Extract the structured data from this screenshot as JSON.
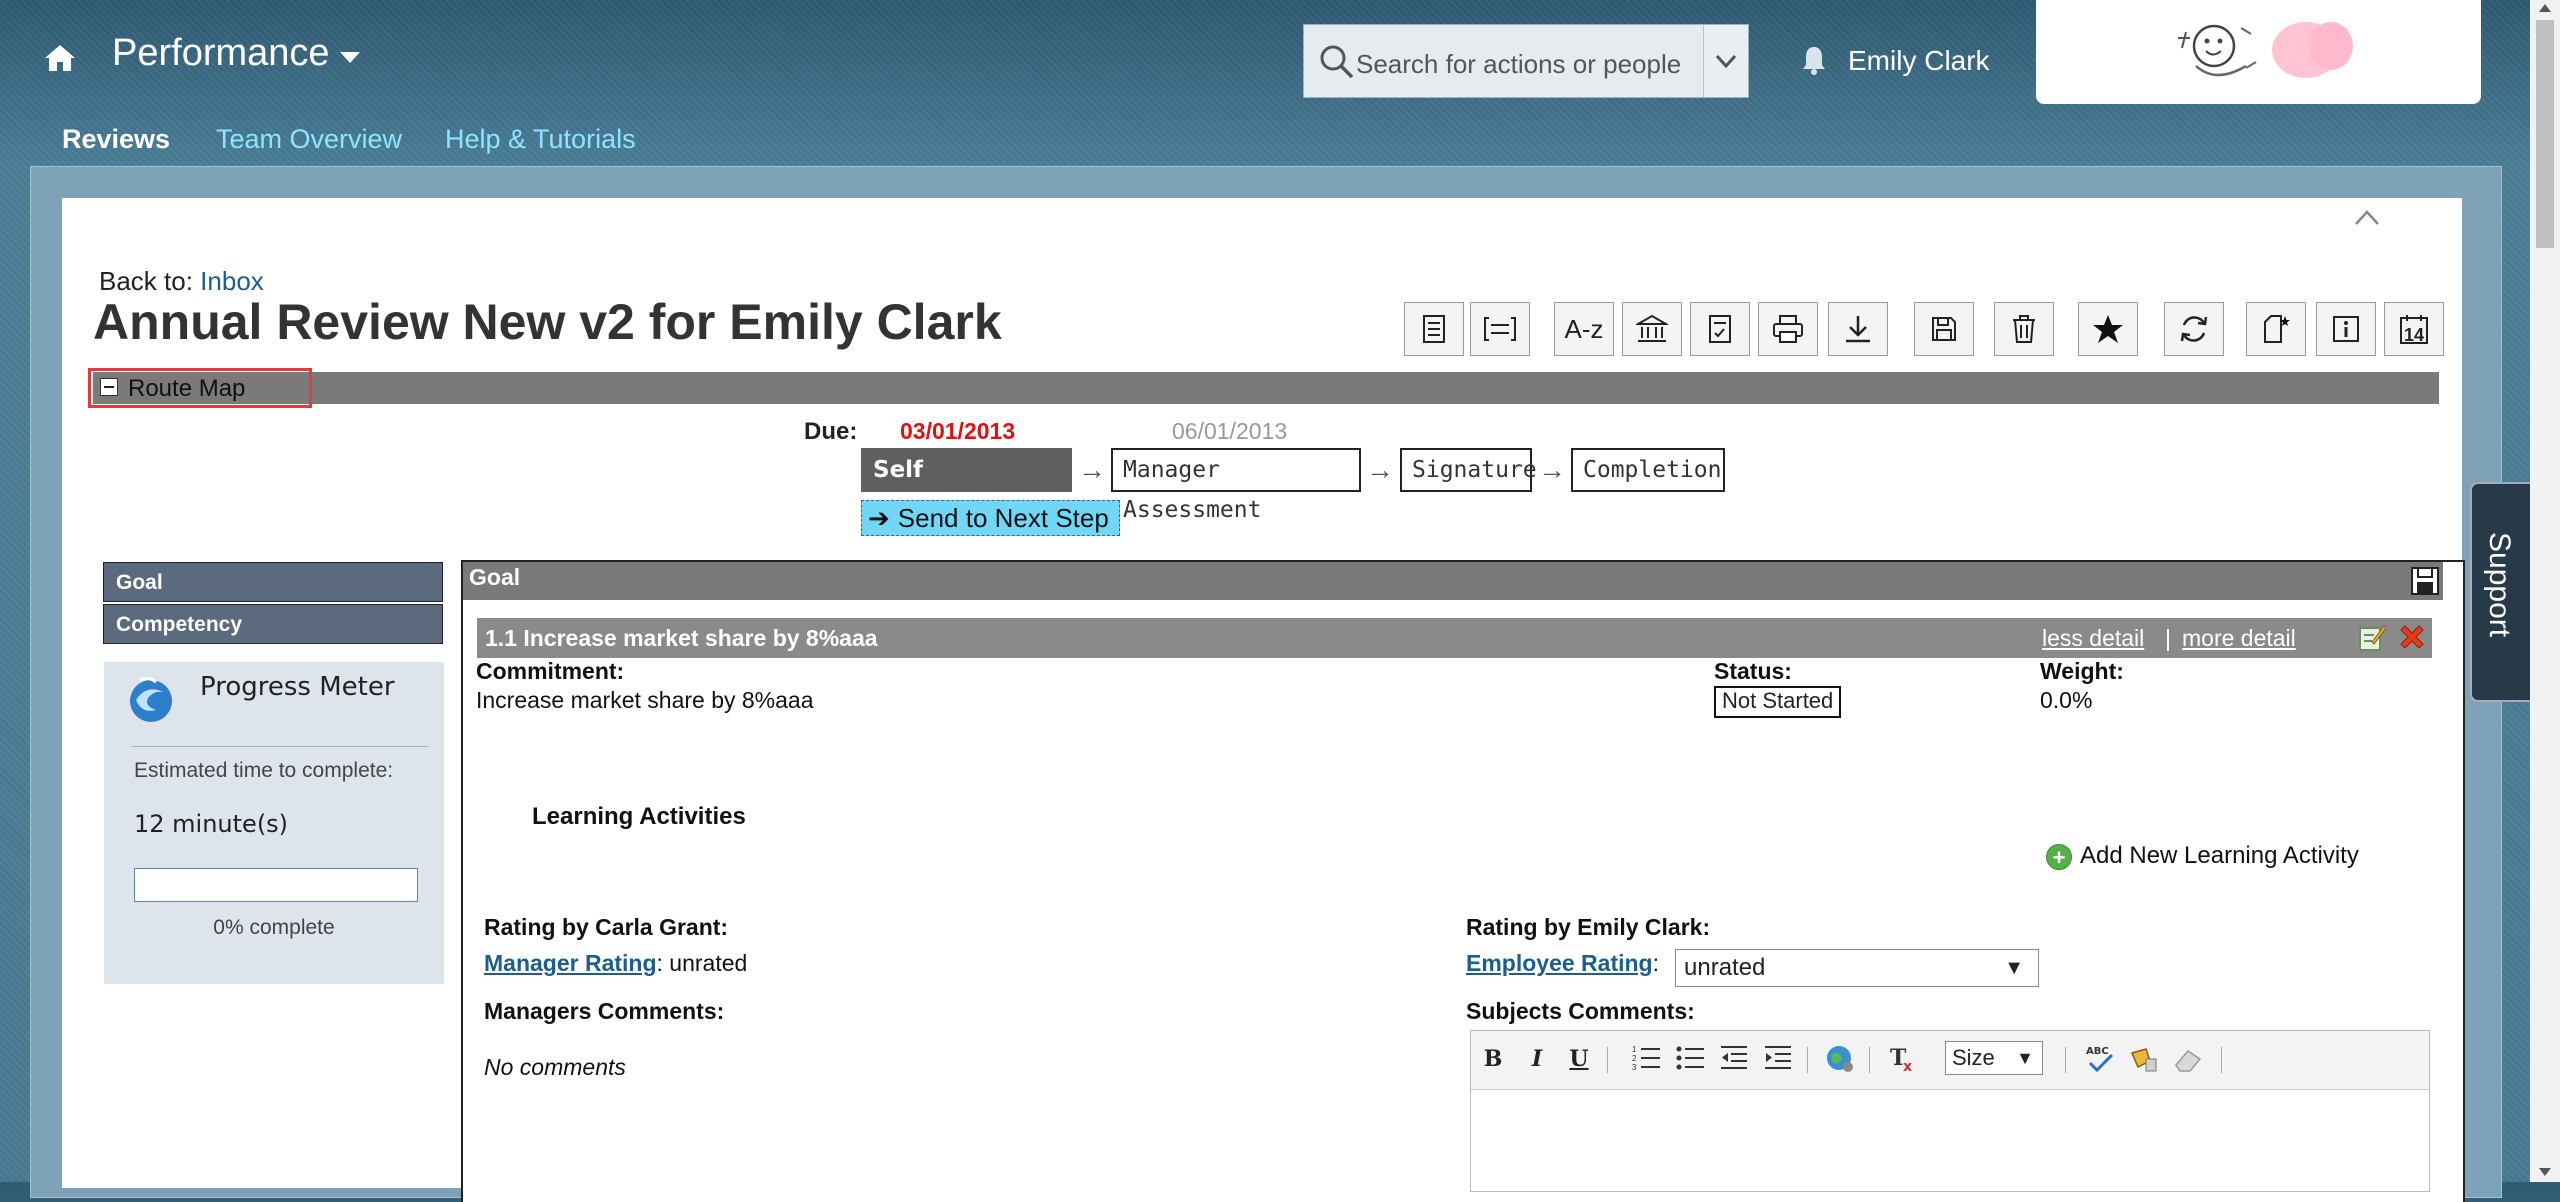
{
  "header": {
    "app_title": "Performance",
    "search_placeholder": "Search for actions or people",
    "user_name": "Emily Clark",
    "nav_tabs": [
      {
        "label": "Reviews"
      },
      {
        "label": "Team Overview"
      },
      {
        "label": "Help & Tutorials"
      }
    ]
  },
  "page": {
    "back_to_label": "Back to:",
    "back_to_link": "Inbox",
    "title": "Annual Review New v2 for Emily Clark"
  },
  "toolbar": {
    "icons": [
      "list-icon",
      "bracket-list-icon",
      "sort-az-icon",
      "bank-icon",
      "checklist-icon",
      "print-icon",
      "download-icon",
      "save-icon",
      "trash-icon",
      "star-icon",
      "refresh-icon",
      "new-doc-icon",
      "info-icon",
      "calendar-icon"
    ],
    "sort_label": "A-z",
    "calendar_label": "14"
  },
  "route_map": {
    "label": "Route Map",
    "due_label": "Due:",
    "due_current": "03/01/2013",
    "due_next": "06/01/2013",
    "steps": [
      {
        "label": "Self Assessment"
      },
      {
        "label": "Manager Assessment"
      },
      {
        "label": "Signature"
      },
      {
        "label": "Completion"
      }
    ],
    "send_button": "Send to Next Step"
  },
  "sidebar": {
    "items": [
      {
        "label": "Goal"
      },
      {
        "label": "Competency"
      }
    ],
    "progress": {
      "title": "Progress Meter",
      "estimate_label": "Estimated time to complete:",
      "estimate_value": "12 minute(s)",
      "percent_value": 0,
      "percent_label": "0% complete"
    }
  },
  "goal": {
    "section_title": "Goal",
    "item_title": "1.1 Increase market share by 8%aaa",
    "less_detail": "less detail",
    "separator": "|",
    "more_detail": "more detail",
    "commitment_label": "Commitment:",
    "commitment_value": "Increase market share by 8%aaa",
    "status_label": "Status:",
    "status_value": "Not Started",
    "weight_label": "Weight:",
    "weight_value": "0.0%",
    "learning_title": "Learning Activities",
    "add_learning": "Add New Learning Activity",
    "manager_rating_by": "Rating by Carla Grant:",
    "manager_rating_link": "Manager Rating",
    "manager_rating_value": ": unrated",
    "employee_rating_by": "Rating by Emily Clark:",
    "employee_rating_link": "Employee Rating",
    "employee_rating_colon": ":",
    "employee_rating_select": "unrated",
    "managers_comments_label": "Managers Comments:",
    "managers_comments_value": "No comments",
    "subjects_comments_label": "Subjects Comments:",
    "editor_size_label": "Size"
  },
  "support_tab": "Support",
  "colors": {
    "header_bg": "#3f6f88",
    "link_cyan": "#8ee4ff",
    "due_red": "#e01010",
    "send_button": "#72d7f7",
    "section_bar": "#7a7a7a",
    "highlight_red": "#e23b3b"
  }
}
